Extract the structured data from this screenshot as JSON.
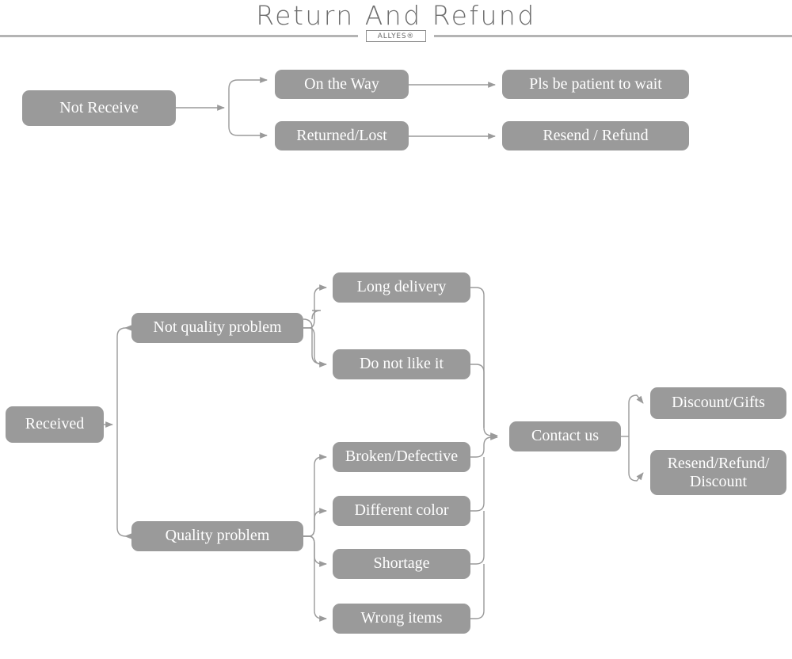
{
  "header": {
    "title": "Return And Refund",
    "brand": "ALLYES®"
  },
  "colors": {
    "node_fill": "#9a9a9a",
    "node_text": "#ffffff",
    "line": "#9a9a9a",
    "rule": "#b4b4b4",
    "title_text": "#6d6d6d"
  },
  "flow_not_received": {
    "root": "Not Receive",
    "branches": [
      {
        "cause": "On the Way",
        "outcome": "Pls be patient to wait"
      },
      {
        "cause": "Returned/Lost",
        "outcome": "Resend / Refund"
      }
    ]
  },
  "flow_received": {
    "root": "Received",
    "categories": [
      {
        "label": "Not quality problem",
        "reasons": [
          "Long delivery",
          "Do not like it"
        ]
      },
      {
        "label": "Quality problem",
        "reasons": [
          "Broken/Defective",
          "Different color",
          "Shortage",
          "Wrong items"
        ]
      }
    ],
    "merge": "Contact us",
    "outcomes": [
      "Discount/Gifts",
      "Resend/Refund/\nDiscount"
    ],
    "outcome_lines": [
      [
        "Discount/Gifts"
      ],
      [
        "Resend/Refund/",
        "Discount"
      ]
    ]
  }
}
